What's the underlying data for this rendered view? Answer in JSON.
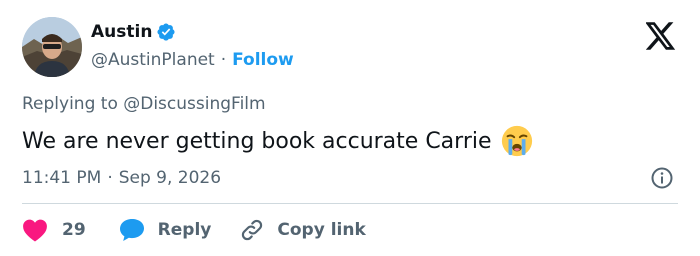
{
  "author": {
    "name": "Austin",
    "handle": "@AustinPlanet",
    "separator": "·",
    "follow_label": "Follow",
    "verified": true
  },
  "tweet": {
    "reply_to": "Replying to @DiscussingFilm",
    "text": "We are never getting book accurate Carrie",
    "emoji": "loudly-crying-face",
    "time": "11:41 PM",
    "separator": "·",
    "date": "Sep 9, 2026"
  },
  "actions": {
    "like_count": "29",
    "reply_label": "Reply",
    "copy_label": "Copy link"
  },
  "colors": {
    "accent": "#1d9bf0",
    "like": "#f91880",
    "secondary_text": "#536471",
    "primary_text": "#0f1419"
  },
  "icons": [
    "verified-badge-icon",
    "x-logo-icon",
    "info-icon",
    "heart-icon",
    "reply-bubble-icon",
    "link-icon"
  ]
}
